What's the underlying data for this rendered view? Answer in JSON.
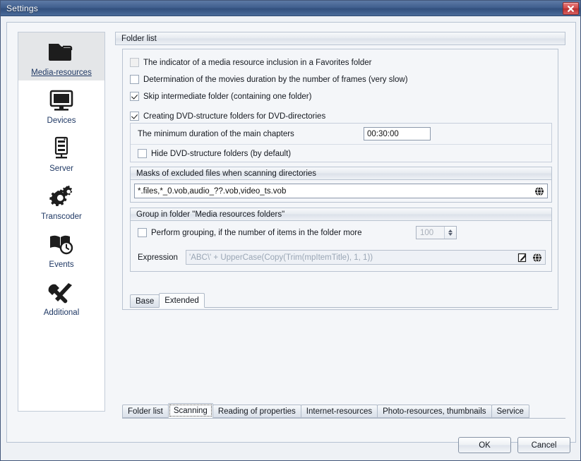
{
  "window": {
    "title": "Settings",
    "close_label": "Close"
  },
  "sidebar": {
    "items": [
      {
        "label": "Media-resources",
        "icon": "folder-icon",
        "selected": true
      },
      {
        "label": "Devices",
        "icon": "monitor-icon",
        "selected": false
      },
      {
        "label": "Server",
        "icon": "server-icon",
        "selected": false
      },
      {
        "label": "Transcoder",
        "icon": "gears-icon",
        "selected": false
      },
      {
        "label": "Events",
        "icon": "book-clock-icon",
        "selected": false
      },
      {
        "label": "Additional",
        "icon": "tools-icon",
        "selected": false
      }
    ]
  },
  "folder_list": {
    "group_title": "Folder list",
    "checkboxes": [
      {
        "label": "The indicator of a media resource inclusion in a Favorites folder",
        "checked": false,
        "disabled": true
      },
      {
        "label": "Determination of the movies duration  by the number of frames (very slow)",
        "checked": false,
        "disabled": false
      },
      {
        "label": "Skip intermediate folder (containing one folder)",
        "checked": true,
        "disabled": false
      },
      {
        "label": "Creating DVD-structure folders for DVD-directories",
        "checked": true,
        "disabled": false
      }
    ],
    "min_duration": {
      "label": "The minimum duration of the main chapters",
      "value": "00:30:00"
    },
    "hide_dvd": {
      "label": "Hide DVD-structure folders (by default)",
      "checked": false
    }
  },
  "masks": {
    "group_title": "Masks of excluded files when scanning directories",
    "value": "*.files,*_0.vob,audio_??.vob,video_ts.vob",
    "globe_icon": "globe-icon"
  },
  "grouping": {
    "group_title": "Group in folder \"Media resources folders\"",
    "perform": {
      "label": "Perform grouping, if the number of items in the folder more",
      "checked": false
    },
    "count": "100",
    "expression": {
      "label": "Expression",
      "value": "'ABC\\' + UpperCase(Copy(Trim(mpItemTitle), 1, 1))"
    },
    "edit_icon": "edit-icon",
    "globe_icon": "globe-icon"
  },
  "inner_tabs": [
    {
      "label": "Base",
      "active": false
    },
    {
      "label": "Extended",
      "active": true
    }
  ],
  "bottom_tabs": [
    {
      "label": "Folder list",
      "active": false,
      "focused": false
    },
    {
      "label": "Scanning",
      "active": true,
      "focused": true
    },
    {
      "label": "Reading of properties",
      "active": false,
      "focused": false
    },
    {
      "label": "Internet-resources",
      "active": false,
      "focused": false
    },
    {
      "label": "Photo-resources, thumbnails",
      "active": false,
      "focused": false
    },
    {
      "label": "Service",
      "active": false,
      "focused": false
    }
  ],
  "buttons": {
    "ok": "OK",
    "cancel": "Cancel"
  },
  "colors": {
    "titlebar": "#41608f",
    "close_red": "#d14b4b",
    "link_blue": "#1f3864",
    "panel_bg": "#f4f6f9"
  }
}
